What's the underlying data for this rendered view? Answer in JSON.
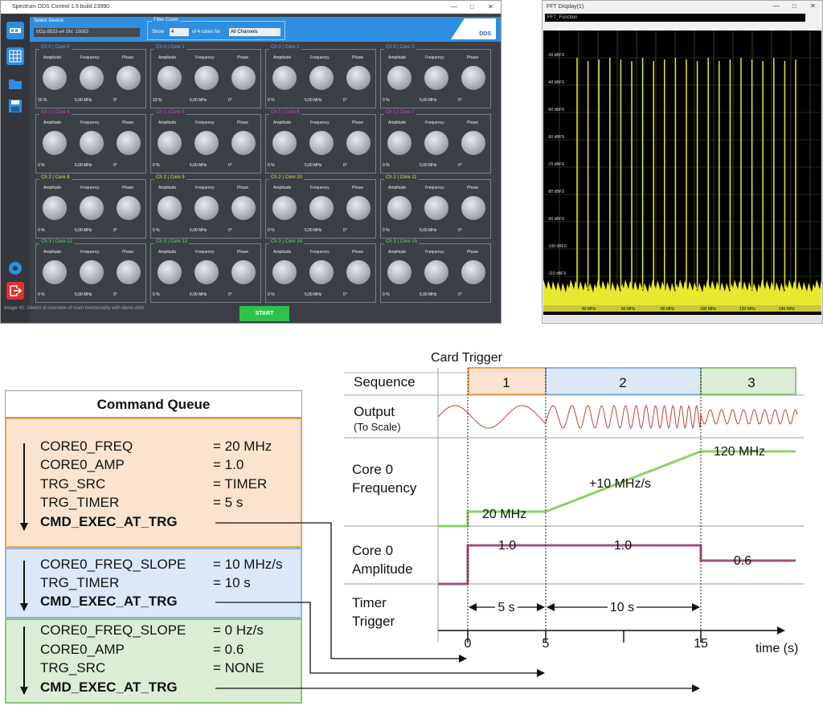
{
  "dds_window": {
    "title": "Spectrum DDS Control 1.5 build 23990",
    "select_device_label": "Select Device:",
    "device": "M2p.6533-x4 SN: 15083",
    "filter_label": "Filter Cores",
    "show_label": "Show",
    "show_value": "4",
    "of_label": "of 4 cores for",
    "channel_filter": "All Channels",
    "logo": "DDS",
    "headers": [
      "Amplitude",
      "Frequency",
      "Phase"
    ],
    "cores": [
      {
        "title": "Ch 0 | Core 0",
        "amp": "10 %",
        "freq": "5,00 MHz",
        "phase": "0°",
        "color": "#5aa8f0"
      },
      {
        "title": "Ch 0 | Core 1",
        "amp": "10 %",
        "freq": "5,00 MHz",
        "phase": "0°",
        "color": "#5aa8f0"
      },
      {
        "title": "Ch 0 | Core 2",
        "amp": "0 %",
        "freq": "5,00 MHz",
        "phase": "0°",
        "color": "#5aa8f0"
      },
      {
        "title": "Ch 0 | Core 3",
        "amp": "0 %",
        "freq": "5,00 MHz",
        "phase": "0°",
        "color": "#5aa8f0"
      },
      {
        "title": "Ch 1 | Core 4",
        "amp": "0 %",
        "freq": "5,00 MHz",
        "phase": "0°",
        "color": "#e040e0"
      },
      {
        "title": "Ch 1 | Core 5",
        "amp": "0 %",
        "freq": "5,00 MHz",
        "phase": "0°",
        "color": "#e040e0"
      },
      {
        "title": "Ch 1 | Core 6",
        "amp": "0 %",
        "freq": "5,00 MHz",
        "phase": "0°",
        "color": "#e040e0"
      },
      {
        "title": "Ch 1 | Core 7",
        "amp": "0 %",
        "freq": "5,00 MHz",
        "phase": "0°",
        "color": "#e040e0"
      },
      {
        "title": "Ch 2 | Core 8",
        "amp": "0 %",
        "freq": "5,00 MHz",
        "phase": "0°",
        "color": "#e8e040"
      },
      {
        "title": "Ch 2 | Core 9",
        "amp": "0 %",
        "freq": "5,00 MHz",
        "phase": "0°",
        "color": "#e8e040"
      },
      {
        "title": "Ch 2 | Core 10",
        "amp": "0 %",
        "freq": "5,00 MHz",
        "phase": "0°",
        "color": "#e8e040"
      },
      {
        "title": "Ch 2 | Core 11",
        "amp": "0 %",
        "freq": "5,00 MHz",
        "phase": "0°",
        "color": "#e8e040"
      },
      {
        "title": "Ch 3 | Core 12",
        "amp": "0 %",
        "freq": "5,00 MHz",
        "phase": "0°",
        "color": "#60e060"
      },
      {
        "title": "Ch 3 | Core 13",
        "amp": "0 %",
        "freq": "5,00 MHz",
        "phase": "0°",
        "color": "#60e060"
      },
      {
        "title": "Ch 3 | Core 14",
        "amp": "0 %",
        "freq": "5,00 MHz",
        "phase": "0°",
        "color": "#60e060"
      },
      {
        "title": "Ch 3 | Core 15",
        "amp": "0 %",
        "freq": "5,00 MHz",
        "phase": "0°",
        "color": "#60e060"
      }
    ],
    "start_label": "START",
    "caption": "Image 41: Sketch & overview of main functionality with demo dots",
    "side_icons": [
      "connect-icon",
      "grid-icon",
      "folder-icon",
      "save-icon",
      "settings-icon",
      "exit-icon"
    ]
  },
  "fft_window": {
    "title": "FFT Display(1)",
    "subtitle": "FFT_Function",
    "y_labels": [
      "-30 dBFS",
      "-40 dBFS",
      "-50 dBFS",
      "-60 dBFS",
      "-70 dBFS",
      "-80 dBFS",
      "-90 dBFS",
      "-100 dBFS",
      "-110 dBFS"
    ],
    "x_labels": [
      "40 MHz",
      "60 MHz",
      "80 MHz",
      "100 MHz",
      "120 MHz",
      "140 MHz"
    ],
    "trace_color": "#e8e830"
  },
  "queue": {
    "title": "Command Queue",
    "blocks": [
      {
        "color": "orange",
        "lines": [
          {
            "cmd": "CORE0_FREQ",
            "val": "= 20 MHz"
          },
          {
            "cmd": "CORE0_AMP",
            "val": "= 1.0"
          },
          {
            "cmd": "TRG_SRC",
            "val": "= TIMER"
          },
          {
            "cmd": "TRG_TIMER",
            "val": "= 5 s"
          },
          {
            "cmd": "CMD_EXEC_AT_TRG",
            "val": ""
          }
        ]
      },
      {
        "color": "blue",
        "lines": [
          {
            "cmd": "CORE0_FREQ_SLOPE",
            "val": "= 10 MHz/s"
          },
          {
            "cmd": "TRG_TIMER",
            "val": "= 10 s"
          },
          {
            "cmd": "CMD_EXEC_AT_TRG",
            "val": ""
          }
        ]
      },
      {
        "color": "green",
        "lines": [
          {
            "cmd": "CORE0_FREQ_SLOPE",
            "val": "= 0 Hz/s"
          },
          {
            "cmd": "CORE0_AMP",
            "val": "= 0.6"
          },
          {
            "cmd": "TRG_SRC",
            "val": "= NONE"
          },
          {
            "cmd": "CMD_EXEC_AT_TRG",
            "val": ""
          }
        ]
      }
    ]
  },
  "timing": {
    "card_trigger_label": "Card Trigger",
    "sequence_label": "Sequence",
    "sequence_numbers": [
      "1",
      "2",
      "3"
    ],
    "output_label": "Output",
    "output_sub": "(To Scale)",
    "freq_label_1": "Core 0",
    "freq_label_2": "Frequency",
    "freq_points": [
      "20 MHz",
      "+10 MHz/s",
      "120 MHz"
    ],
    "amp_label_1": "Core 0",
    "amp_label_2": "Amplitude",
    "amp_points": [
      "1.0",
      "1.0",
      "0.6"
    ],
    "timer_label_1": "Timer",
    "timer_label_2": "Trigger",
    "intervals": [
      "5 s",
      "10 s"
    ],
    "ticks": [
      "0",
      "5",
      "15"
    ],
    "axis_label": "time (s)"
  },
  "colors": {
    "orange_fill": "#fbe3cf",
    "orange_border": "#e8a35a",
    "blue_fill": "#dce8f8",
    "blue_border": "#8fb3e0",
    "green_fill": "#dcedd6",
    "green_border": "#8fc27f",
    "freq_line": "#8cd068",
    "amp_line": "#a0527c",
    "output_line": "#c0403c"
  }
}
